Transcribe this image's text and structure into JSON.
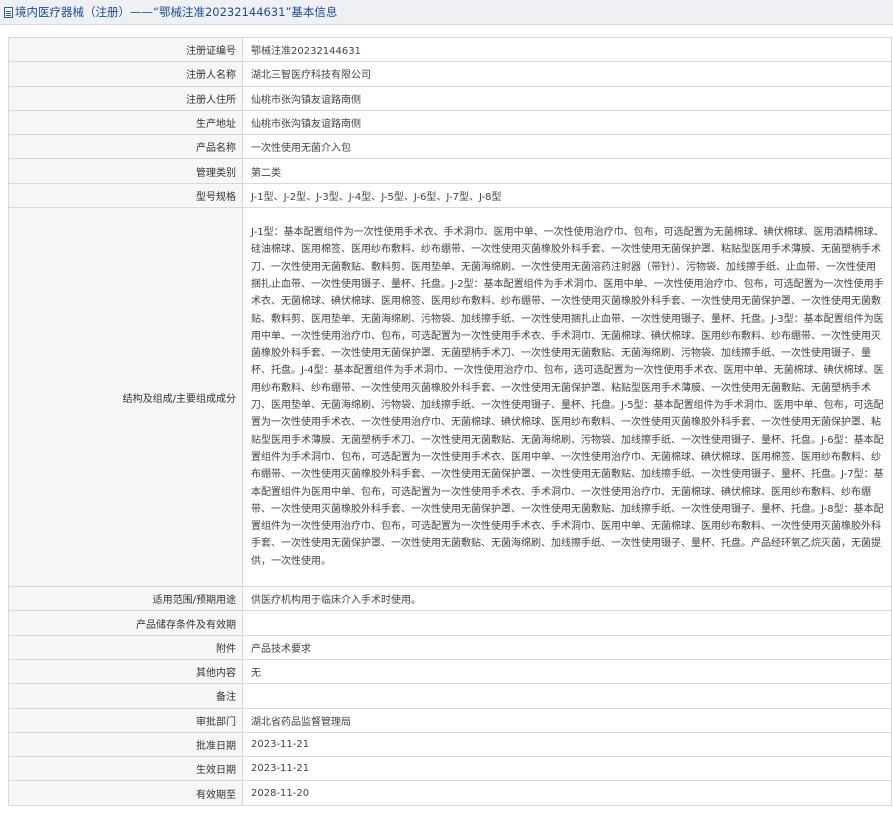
{
  "header": {
    "title": "境内医疗器械（注册）——“鄂械注准20232144631”基本信息"
  },
  "rows": [
    {
      "label": "注册证编号",
      "value": "鄂械注准20232144631"
    },
    {
      "label": "注册人名称",
      "value": "湖北三智医疗科技有限公司"
    },
    {
      "label": "注册人住所",
      "value": "仙桃市张沟镇友谊路南侧"
    },
    {
      "label": "生产地址",
      "value": "仙桃市张沟镇友谊路南侧"
    },
    {
      "label": "产品名称",
      "value": "一次性使用无菌介入包"
    },
    {
      "label": "管理类别",
      "value": "第二类"
    },
    {
      "label": "型号规格",
      "value": "J-1型、J-2型、J-3型、J-4型、J-5型、J-6型、J-7型、J-8型"
    },
    {
      "label": "结构及组成/主要组成成分",
      "value": "J-1型：基本配置组件为一次性使用手术衣、手术洞巾、医用中单、一次性使用治疗巾、包布，可选配置为无菌棉球、碘伏棉球、医用酒精棉球、硅油棉球、医用棉签、医用纱布敷料、纱布绷带、一次性使用灭菌橡胶外科手套、一次性使用无菌保护罩、粘贴型医用手术薄膜、无菌塑柄手术刀、一次性使用无菌敷贴、敷料剪、医用垫单、无菌海绵刷、一次性使用无菌溶药注射器（带针）、污物袋、加线擦手纸、止血带、一次性使用捆扎止血带、一次性使用镊子、量杯、托盘。J-2型：基本配置组件为手术洞巾、医用中单、一次性使用治疗巾、包布，可选配置为一次性使用手术衣、无菌棉球、碘伏棉球、医用棉签、医用纱布敷料、纱布绷带、一次性使用灭菌橡胶外科手套、一次性使用无菌保护罩、一次性使用无菌敷贴、敷料剪、医用垫单、无菌海绵刷、污物袋、加线擦手纸、一次性使用捆扎止血带、一次性使用镊子、量杯、托盘。J-3型：基本配置组件为医用中单、一次性使用治疗巾、包布，可选配置为一次性使用手术衣、手术洞巾、无菌棉球、碘伏棉球、医用纱布敷料、纱布绷带、一次性使用灭菌橡胶外科手套、一次性使用无菌保护罩、无菌塑柄手术刀、一次性使用无菌敷贴、无菌海绵刷、污物袋、加线擦手纸、一次性使用镊子、量杯、托盘。J-4型：基本配置组件为手术洞巾、一次性使用治疗巾、包布，选可选配置为一次性使用手术衣、医用中单、无菌棉球、碘伏棉球、医用纱布敷料、纱布绷带、一次性使用灭菌橡胶外科手套、一次性使用无菌保护罩、粘贴型医用手术薄膜、一次性使用无菌敷贴、无菌塑柄手术刀、医用垫单、无菌海绵刷、污物袋、加线擦手纸、一次性使用镊子、量杯、托盘。J-5型：基本配置组件为手术洞巾、医用中单、包布，可选配置为一次性使用手术衣、一次性使用治疗巾、无菌棉球、碘伏棉球、医用纱布敷料、一次性使用灭菌橡胶外科手套、一次性使用无菌保护罩、粘贴型医用手术薄膜、无菌塑柄手术刀、一次性使用无菌敷贴、无菌海绵刷、污物袋、加线擦手纸、一次性使用镊子、量杯、托盘。J-6型：基本配置组件为手术洞巾、包布，可选配置为一次性使用手术衣、医用中单、一次性使用治疗巾、无菌棉球、碘伏棉球、医用棉签、医用纱布敷料、纱布绷带、一次性使用灭菌橡胶外科手套、一次性使用无菌保护罩、一次性使用无菌敷贴、加线擦手纸、一次性使用镊子、量杯、托盘。J-7型：基本配置组件为医用中单、包布，可选配置为一次性使用手术衣、手术洞巾、一次性使用治疗巾、无菌棉球、碘伏棉球、医用纱布敷料、纱布绷带、一次性使用灭菌橡胶外科手套、一次性使用无菌保护罩、一次性使用无菌敷贴、加线擦手纸、一次性使用镊子、量杯、托盘。J-8型：基本配置组件为一次性使用治疗巾、包布，可选配置为一次性使用手术衣、手术洞巾、医用中单、无菌棉球、医用纱布敷料、一次性使用灭菌橡胶外科手套、一次性使用无菌保护罩、一次性使用无菌敷贴、无菌海绵刷、加线擦手纸、一次性使用镊子、量杯、托盘。产品经环氧乙烷灭菌，无菌提供，一次性使用。",
      "tall": true
    },
    {
      "label": "适用范围/预期用途",
      "value": "供医疗机构用于临床介入手术时使用。"
    },
    {
      "label": "产品储存条件及有效期",
      "value": ""
    },
    {
      "label": "附件",
      "value": "产品技术要求"
    },
    {
      "label": "其他内容",
      "value": "无"
    },
    {
      "label": "备注",
      "value": ""
    },
    {
      "label": "审批部门",
      "value": "湖北省药品监督管理局"
    },
    {
      "label": "批准日期",
      "value": "2023-11-21"
    },
    {
      "label": "生效日期",
      "value": "2023-11-21"
    },
    {
      "label": "有效期至",
      "value": "2028-11-20"
    }
  ]
}
